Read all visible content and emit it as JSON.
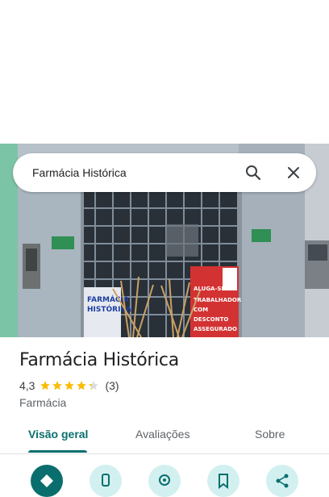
{
  "search": {
    "query": "Farmácia Histórica",
    "search_icon": "search-icon",
    "close_icon": "close-icon"
  },
  "storefront": {
    "left_sign": "Farmácia",
    "left_sign_2": "Histórica",
    "banner_lines": [
      "FARMÁCIA",
      "HISTÓRICA"
    ],
    "poster_lines": [
      "ALUGA-SE",
      "TRABALHADOR",
      "COM",
      "DESCONTO",
      "ASSEGURADO"
    ]
  },
  "place": {
    "title": "Farmácia Histórica",
    "rating": "4,3",
    "stars": 4.3,
    "review_count": "(3)",
    "category": "Farmácia"
  },
  "tabs": [
    {
      "label": "Visão geral",
      "active": true
    },
    {
      "label": "Avaliações",
      "active": false
    },
    {
      "label": "Sobre",
      "active": false
    }
  ],
  "actions": [
    {
      "icon": "directions-icon",
      "primary": true
    },
    {
      "icon": "phone-icon",
      "primary": false
    },
    {
      "icon": "location-icon",
      "primary": false
    },
    {
      "icon": "save-icon",
      "primary": false
    },
    {
      "icon": "share-icon",
      "primary": false
    }
  ],
  "colors": {
    "accent": "#0b6e6e",
    "star": "#fbbc04",
    "action_bg": "#d2f0f0"
  }
}
